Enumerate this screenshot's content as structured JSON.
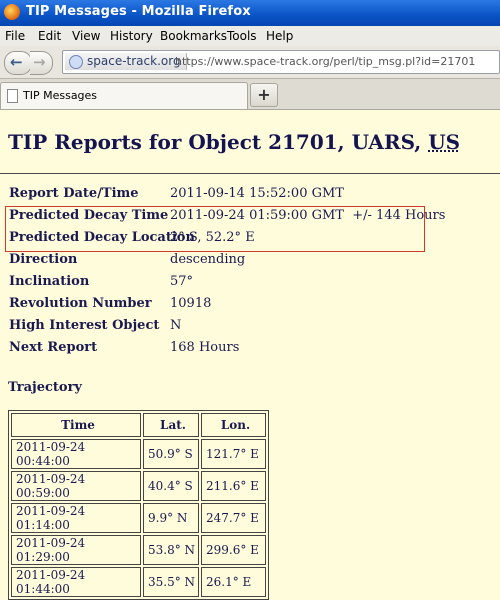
{
  "window": {
    "title": "TIP Messages - Mozilla Firefox"
  },
  "menu": [
    "File",
    "Edit",
    "View",
    "History",
    "Bookmarks",
    "Tools",
    "Help"
  ],
  "urlbar": {
    "site": "space-track.org",
    "url": "https://www.space-track.org/perl/tip_msg.pl?id=21701"
  },
  "tab": {
    "label": "TIP Messages",
    "new_tab": "+"
  },
  "page": {
    "heading": "TIP Reports for Object 21701, UARS,",
    "heading_country": "US",
    "details": [
      {
        "label": "Report Date/Time",
        "value": "2011-09-14 15:52:00 GMT"
      },
      {
        "label": "Predicted Decay Time",
        "value": "2011-09-24 01:59:00 GMT  +/- 144 Hours"
      },
      {
        "label": "Predicted Decay Location",
        "value": "2° S, 52.2° E"
      },
      {
        "label": "Direction",
        "value": "descending"
      },
      {
        "label": "Inclination",
        "value": "57°"
      },
      {
        "label": "Revolution Number",
        "value": "10918"
      },
      {
        "label": "High Interest Object",
        "value": "N"
      },
      {
        "label": "Next Report",
        "value": "168 Hours"
      }
    ],
    "highlight_color": "#d23a2c",
    "trajectory": {
      "title": "Trajectory",
      "headers": [
        "Time",
        "Lat.",
        "Lon."
      ],
      "rows": [
        [
          "2011-09-24 00:44:00",
          "50.9° S",
          "121.7° E"
        ],
        [
          "2011-09-24 00:59:00",
          "40.4° S",
          "211.6° E"
        ],
        [
          "2011-09-24 01:14:00",
          "9.9° N",
          "247.7° E"
        ],
        [
          "2011-09-24 01:29:00",
          "53.8° N",
          "299.6° E"
        ],
        [
          "2011-09-24 01:44:00",
          "35.5° N",
          "26.1° E"
        ]
      ]
    }
  }
}
